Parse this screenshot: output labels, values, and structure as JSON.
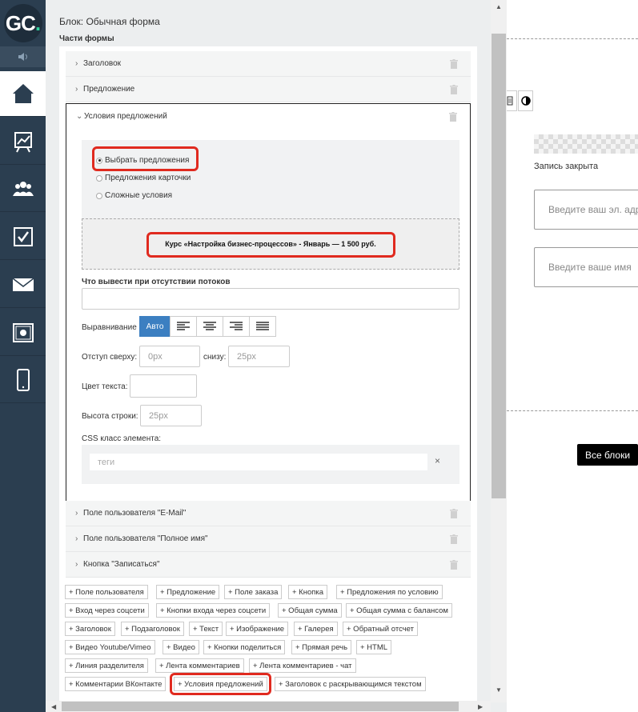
{
  "logo": {
    "text_main": "GC",
    "text_dot": "."
  },
  "nav": {
    "collapse_icon": "speaker-icon",
    "items": [
      "home-icon",
      "chart-icon",
      "users-icon",
      "tasks-icon",
      "mail-icon",
      "safe-icon",
      "mobile-icon"
    ]
  },
  "panel": {
    "title": "Блок: Обычная форма",
    "subtitle": "Части формы",
    "sections_top": [
      {
        "label": "Заголовок"
      },
      {
        "label": "Предложение"
      }
    ],
    "expanded": {
      "label": "Условия предложений",
      "radios": [
        {
          "label": "Выбрать предложения",
          "checked": true
        },
        {
          "label": "Предложения карточки",
          "checked": false
        },
        {
          "label": "Сложные условия",
          "checked": false
        }
      ],
      "offer": "Курс «Настройка бизнес-процессов» - Январь — 1 500 руб.",
      "no_streams_label": "Что вывести при отсутствии потоков",
      "no_streams_value": "",
      "align_label": "Выравнивание",
      "align_auto": "Авто",
      "margin_top_label": "Отступ сверху:",
      "margin_top_placeholder": "0px",
      "margin_bottom_label": "снизу:",
      "margin_bottom_placeholder": "25px",
      "text_color_label": "Цвет текста:",
      "line_height_label": "Высота строки:",
      "line_height_placeholder": "25px",
      "css_label": "CSS класс элемента:",
      "css_placeholder": "теги",
      "css_clear": "×"
    },
    "sections_bottom": [
      {
        "label": "Поле пользователя \"E-Mail\""
      },
      {
        "label": "Поле пользователя \"Полное имя\""
      },
      {
        "label": "Кнопка \"Записаться\""
      }
    ],
    "add_buttons": [
      "+ Поле пользователя",
      "+ Предложение",
      "+ Поле заказа",
      "+ Кнопка",
      "+ Предложения по условию",
      "+ Вход через соцсети",
      "+ Кнопки входа через соцсети",
      "+ Общая сумма",
      "+ Общая сумма с балансом",
      "+ Заголовок",
      "+ Подзаголовок",
      "+ Текст",
      "+ Изображение",
      "+ Галерея",
      "+ Обратный отсчет",
      "+ Видео Youtube/Vimeo",
      "+ Видео",
      "+ Кнопки поделиться",
      "+ Прямая речь",
      "+ HTML",
      "+ Линия разделителя",
      "+ Лента комментариев",
      "+ Лента комментариев - чат",
      "+ Комментарии ВКонтакте",
      "+ Условия предложений",
      "+ Заголовок с раскрывающимся текстом"
    ]
  },
  "preview": {
    "closed_text": "Запись закрыта",
    "email_placeholder": "Введите ваш эл. адрес",
    "name_placeholder": "Введите ваше имя",
    "all_blocks": "Все блоки",
    "contrast_icon": "contrast-icon",
    "code_icon": "code-icon"
  },
  "colors": {
    "accent": "#3c7fc1",
    "highlight": "#e02a1f",
    "nav_bg": "#2b3e50",
    "brand_dot": "#2fcf9c"
  }
}
